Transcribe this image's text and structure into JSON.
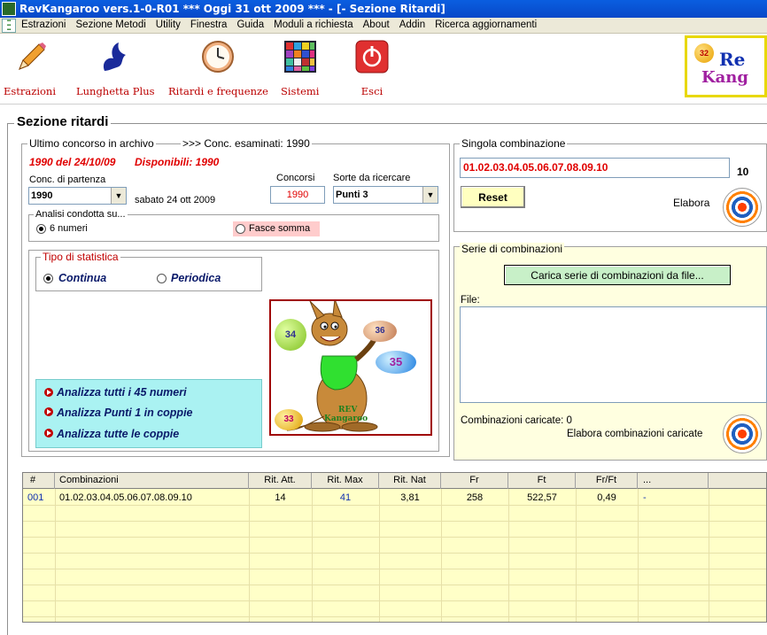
{
  "window": {
    "title": "RevKangaroo vers.1-0-R01  ***  Oggi 31 ott 2009  ***   - [- Sezione Ritardi]"
  },
  "menu": [
    "Estrazioni",
    "Sezione Metodi",
    "Utility",
    "Finestra",
    "Guida",
    "Moduli a richiesta",
    "About",
    "Addin",
    "Ricerca aggiornamenti"
  ],
  "toolbar": {
    "estrazioni": "Estrazioni",
    "lunghetta": "Lunghetta Plus",
    "ritardi": "Ritardi e frequenze",
    "sistemi": "Sistemi",
    "esci": "Esci"
  },
  "logo": {
    "ball": "32",
    "line1": "Re",
    "line2": "Kang"
  },
  "section": {
    "title": "Sezione ritardi"
  },
  "archive": {
    "title": "Ultimo concorso in archivo",
    "examined": ">>> Conc. esaminati: 1990",
    "last": "1990 del 24/10/09",
    "available": "Disponibili: 1990",
    "start_label": "Conc. di partenza",
    "start_value": "1990",
    "start_date": "sabato 24 ott 2009",
    "concorsi_label": "Concorsi",
    "concorsi_value": "1990",
    "sorte_label": "Sorte da ricercare",
    "sorte_value": "Punti 3"
  },
  "analisi": {
    "title": "Analisi condotta su...",
    "opt_numeri": "6 numeri",
    "opt_fasce": "Fasce somma"
  },
  "statistica": {
    "title": "Tipo di statistica",
    "continua": "Continua",
    "periodica": "Periodica"
  },
  "actions": {
    "a1": "Analizza tutti i 45 numeri",
    "a2": "Analizza Punti 1 in coppie",
    "a3": "Analizza tutte le coppie"
  },
  "kangaroo": {
    "b1": "34",
    "b2": "36",
    "b3": "35",
    "b4": "33",
    "t1": "REV",
    "t2": "Kangaroo"
  },
  "singola": {
    "title": "Singola combinazione",
    "value": "01.02.03.04.05.06.07.08.09.10",
    "count": "10",
    "reset": "Reset",
    "elabora": "Elabora"
  },
  "serie": {
    "title": "Serie di combinazioni",
    "load_button": "Carica serie di combinazioni da file...",
    "file_label": "File:",
    "loaded": "Combinazioni caricate: 0",
    "elabora": "Elabora combinazioni caricate"
  },
  "grid": {
    "headers": [
      "#",
      "Combinazioni",
      "Rit. Att.",
      "Rit. Max",
      "Rit. Nat",
      "Fr",
      "Ft",
      "Fr/Ft",
      "..."
    ],
    "rows": [
      [
        "001",
        "01.02.03.04.05.06.07.08.09.10",
        "14",
        "41",
        "3,81",
        "258",
        "522,57",
        "0,49",
        "-"
      ]
    ]
  }
}
